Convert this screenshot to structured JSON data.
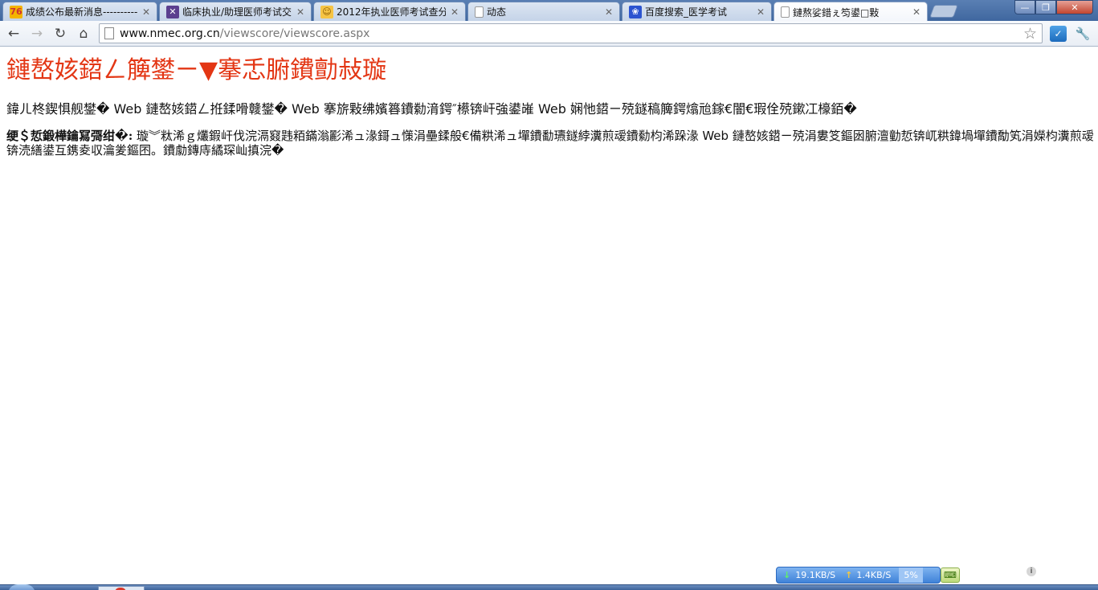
{
  "browser": {
    "tabs": [
      {
        "title": "成绩公布最新消息----------",
        "favicon": "site-logo-icon",
        "favicon_text": "76",
        "active": false
      },
      {
        "title": "临床执业/助理医师考试交",
        "favicon": "forum-logo-icon",
        "favicon_text": "✕",
        "active": false
      },
      {
        "title": "2012年执业医师考试查分",
        "favicon": "award-icon",
        "favicon_text": "☺",
        "active": false
      },
      {
        "title": "动态",
        "favicon": "page-icon",
        "favicon_text": "",
        "active": false
      },
      {
        "title": "百度搜索_医学考试",
        "favicon": "baidu-paw-icon",
        "favicon_text": "❀",
        "active": false
      },
      {
        "title": "鏈熬娑錯ぇ笉鍙□敤",
        "favicon": "page-icon",
        "favicon_text": "",
        "active": true
      }
    ],
    "close_glyph": "✕",
    "window_buttons": {
      "minimize": "—",
      "maximize": "❐",
      "close": "✕"
    },
    "nav": {
      "back": "←",
      "forward": "→",
      "reload": "↻",
      "home": "⌂"
    },
    "address": {
      "host": "www.nmec.org.cn",
      "path": "/viewscore/viewscore.aspx"
    },
    "bookmark_star": "☆",
    "extension_icon_text": "✓",
    "wrench_icon": "🔧"
  },
  "page": {
    "title": "鏈嶅姟鍣ㄥ簲鐢ㄧ▼搴忎腑鐨勯敊璇",
    "paragraph1": "鍏ㄦ柊鍥惧舰鐢� Web 鏈嶅姟鍣ㄥ拰鍒嗗竷鐢� Web 搴旂敤绋嬪簭鐨勬湇鍔″櫒锛屽強鍙嶉 Web 娴忚鍣ㄧ殑鐩稿簲鍔熻兘鎵€闇€瑕佺殑鏉冮檺銆�",
    "paragraph2_label": "绠＄悊鍛樺鑰冩彁绀�:",
    "paragraph2_text": " 璇︾粏浠ｇ爜鍜屽伐浣滆窡韪粨鏋滃彲浠ュ湪鎶ュ憡涓壘鍒般€備粠浠ュ墠鐨勫瓙鐩綍瀵煎叆鐨勬枃浠跺湪 Web 鏈嶅姟鍣ㄧ殑涓婁笅鏂囦腑澶勭悊锛屼粠鍏堝墠鐨勪笂涓嬫枃瀵煎叆锛涜繕鍙互鎸夌収瀹夎鏂囨。鐨勮鏄庤繘琛屾搷浣�"
  },
  "status": {
    "download_speed": "19.1KB/S",
    "upload_speed": "1.4KB/S",
    "cpu_percent": "5%",
    "down_arrow": "↓",
    "up_arrow": "↑",
    "keyboard_icon": "⌨",
    "info_icon": "i"
  }
}
